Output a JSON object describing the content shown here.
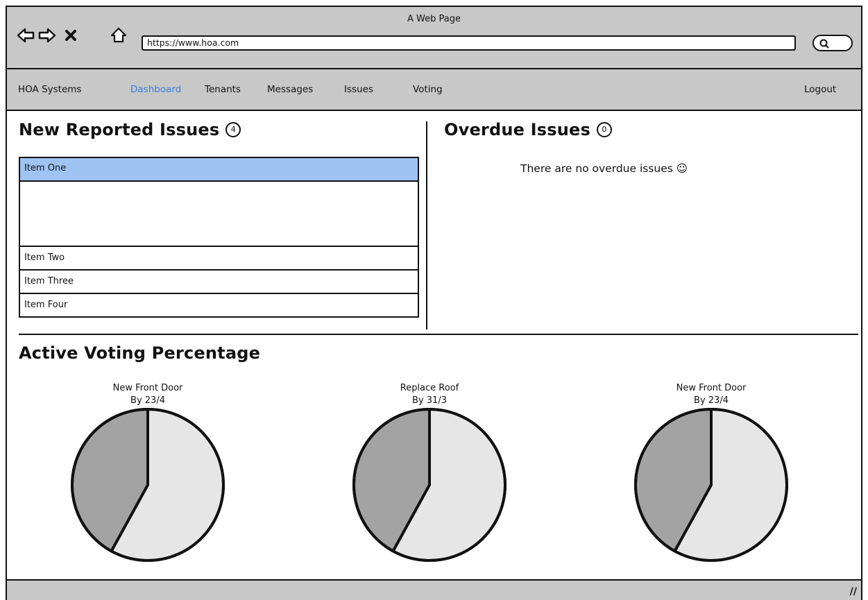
{
  "window": {
    "title": "A Web Page",
    "url": "https://www.hoa.com"
  },
  "icons": {
    "back": "back-arrow-icon",
    "forward": "forward-arrow-icon",
    "close": "close-icon",
    "home": "home-icon",
    "search": "search-icon",
    "resize": "resize-grip-icon"
  },
  "nav": {
    "brand": "HOA Systems",
    "items": [
      {
        "label": "Dashboard",
        "active": true
      },
      {
        "label": "Tenants"
      },
      {
        "label": "Messages"
      },
      {
        "label": "Issues"
      },
      {
        "label": "Voting"
      }
    ],
    "logout": "Logout"
  },
  "new_issues": {
    "title": "New Reported Issues",
    "count": "4",
    "items": [
      "Item One",
      "Item Two",
      "Item Three",
      "Item Four"
    ]
  },
  "overdue": {
    "title": "Overdue Issues",
    "count": "0",
    "empty_message": "There are no overdue issues ☺"
  },
  "voting": {
    "title": "Active Voting Percentage",
    "polls": [
      {
        "name": "New Front Door",
        "deadline": "By 23/4"
      },
      {
        "name": "Replace Roof",
        "deadline": "By 31/3"
      },
      {
        "name": "New Front Door",
        "deadline": "By 23/4"
      }
    ]
  },
  "colors": {
    "chrome": "#c8c8c8",
    "active_link": "#3b7ddd",
    "selected_row": "#9fc3f3",
    "pie_dark": "#a3a3a3",
    "pie_light": "#e6e6e6"
  },
  "chart_data": [
    {
      "type": "pie",
      "title": "New Front Door",
      "subtitle": "By 23/4",
      "values": [
        58,
        42
      ]
    },
    {
      "type": "pie",
      "title": "Replace Roof",
      "subtitle": "By 31/3",
      "values": [
        58,
        42
      ]
    },
    {
      "type": "pie",
      "title": "New Front Door",
      "subtitle": "By 23/4",
      "values": [
        58,
        42
      ]
    }
  ]
}
